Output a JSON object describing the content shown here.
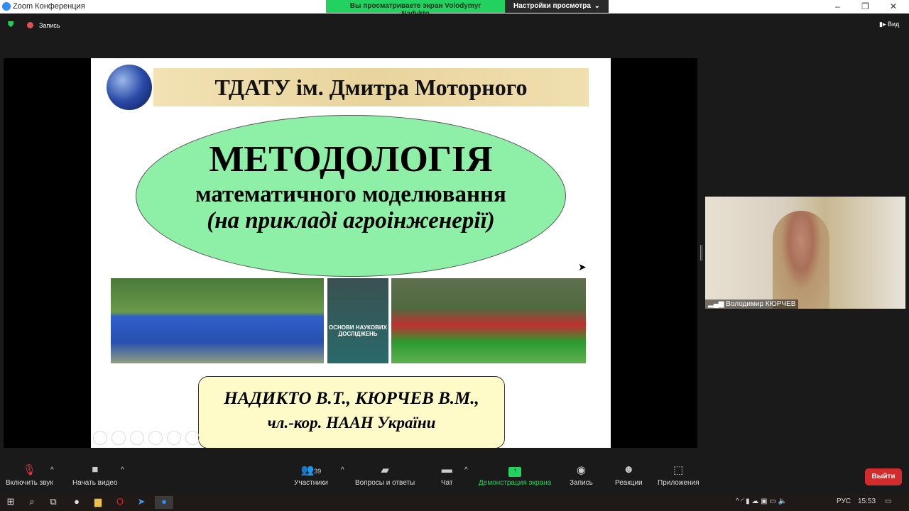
{
  "window": {
    "title": "Zoom Конференция",
    "minimize": "–",
    "restore": "❐",
    "close": "✕"
  },
  "banner": {
    "viewing": "Вы просматриваете экран Volodymyr Nadykto",
    "settings": "Настройки просмотра",
    "chevron": "⌄"
  },
  "topbar": {
    "record": "Запись",
    "view": "Вид"
  },
  "slide": {
    "header": "ТДАТУ ім. Дмитра Моторного",
    "title": "МЕТОДОЛОГІЯ",
    "subtitle": "математичного моделювання",
    "subtitle2": "(на прикладі агроінженерії)",
    "book": "ОСНОВИ НАУКОВИХ ДОСЛІДЖЕНЬ",
    "authors": "НАДИКТО В.Т., КЮРЧЕВ В.М.,",
    "authors2": "чл.-кор. НААН України"
  },
  "participant": {
    "name": "Володимир КЮРЧЕВ"
  },
  "toolbar": {
    "unmute": "Включить звук",
    "video": "Начать видео",
    "participants": "Участники",
    "participants_count": "39",
    "qa": "Вопросы и ответы",
    "chat": "Чат",
    "share": "Демонстрация экрана",
    "record": "Запись",
    "reactions": "Реакции",
    "apps": "Приложения",
    "exit": "Выйти"
  },
  "taskbar": {
    "lang": "РУС",
    "time": "15:53"
  },
  "colors": {
    "share_green": "#23d160",
    "exit_red": "#d12b2b",
    "ellipse": "#8ef0a6"
  }
}
